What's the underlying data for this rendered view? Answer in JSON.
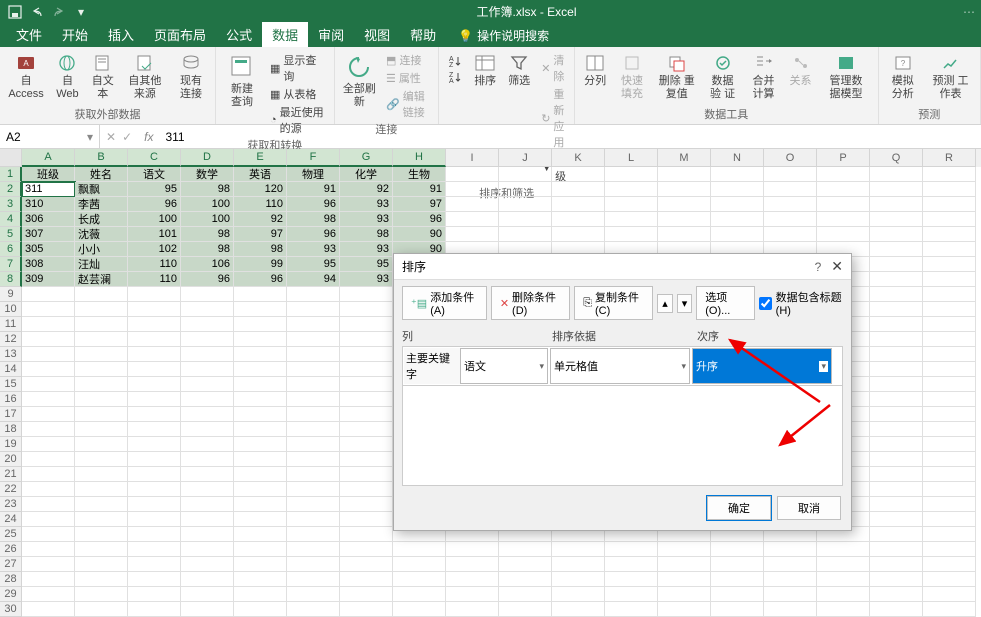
{
  "app": {
    "title": "工作簿.xlsx  -  Excel"
  },
  "tabs": {
    "file": "文件",
    "home": "开始",
    "insert": "插入",
    "layout": "页面布局",
    "formulas": "公式",
    "data": "数据",
    "review": "审阅",
    "view": "视图",
    "help": "帮助",
    "tellme": "操作说明搜索"
  },
  "ribbon": {
    "getdata": {
      "access": "自 Access",
      "web": "自 Web",
      "text": "自文本",
      "other": "自其他来源",
      "existing": "现有连接",
      "label": "获取外部数据"
    },
    "getransform": {
      "newquery": "新建 查询",
      "showqueries": "显示查询",
      "fromtable": "从表格",
      "recent": "最近使用的源",
      "label": "获取和转换"
    },
    "connections": {
      "refresh": "全部刷新",
      "conn": "连接",
      "props": "属性",
      "editlinks": "编辑链接",
      "label": "连接"
    },
    "sortfilter": {
      "sort": "排序",
      "filter": "筛选",
      "clear": "清除",
      "reapply": "重新应用",
      "advanced": "高级",
      "label": "排序和筛选"
    },
    "datatools": {
      "t2c": "分列",
      "flashfill": "快速填充",
      "dedup": "删除 重复值",
      "validate": "数据验 证",
      "consolidate": "合并计算",
      "relations": "关系",
      "model": "管理数 据模型",
      "label": "数据工具"
    },
    "forecast": {
      "whatif": "模拟分析",
      "forecast": "预测 工作表",
      "label": "预测"
    }
  },
  "formula": {
    "namebox": "A2",
    "value": "311"
  },
  "columns": [
    "A",
    "B",
    "C",
    "D",
    "E",
    "F",
    "G",
    "H",
    "I",
    "J",
    "K",
    "L",
    "M",
    "N",
    "O",
    "P",
    "Q",
    "R"
  ],
  "headers": [
    "班级",
    "姓名",
    "语文",
    "数学",
    "英语",
    "物理",
    "化学",
    "生物"
  ],
  "rows": [
    {
      "r": 1,
      "d": [
        "311",
        "飘飘",
        "95",
        "98",
        "120",
        "91",
        "92",
        "91"
      ]
    },
    {
      "r": 2,
      "d": [
        "310",
        "李茜",
        "96",
        "100",
        "110",
        "96",
        "93",
        "97"
      ]
    },
    {
      "r": 3,
      "d": [
        "306",
        "长成",
        "100",
        "100",
        "92",
        "98",
        "93",
        "96"
      ]
    },
    {
      "r": 4,
      "d": [
        "307",
        "沈薇",
        "101",
        "98",
        "97",
        "96",
        "98",
        "90"
      ]
    },
    {
      "r": 5,
      "d": [
        "305",
        "小小",
        "102",
        "98",
        "98",
        "93",
        "93",
        "90"
      ]
    },
    {
      "r": 6,
      "d": [
        "308",
        "汪灿",
        "110",
        "106",
        "99",
        "95",
        "95",
        ""
      ]
    },
    {
      "r": 7,
      "d": [
        "309",
        "赵芸澜",
        "110",
        "96",
        "96",
        "94",
        "93",
        ""
      ]
    }
  ],
  "dialog": {
    "title": "排序",
    "help": "?",
    "addcond": "添加条件(A)",
    "delcond": "删除条件(D)",
    "copycond": "复制条件(C)",
    "options": "选项(O)...",
    "hasheader": "数据包含标题(H)",
    "col": "列",
    "sortby": "排序依据",
    "order": "次序",
    "keylabel": "主要关键字",
    "keyval": "语文",
    "sortval": "单元格值",
    "orderval": "升序",
    "ok": "确定",
    "cancel": "取消"
  }
}
